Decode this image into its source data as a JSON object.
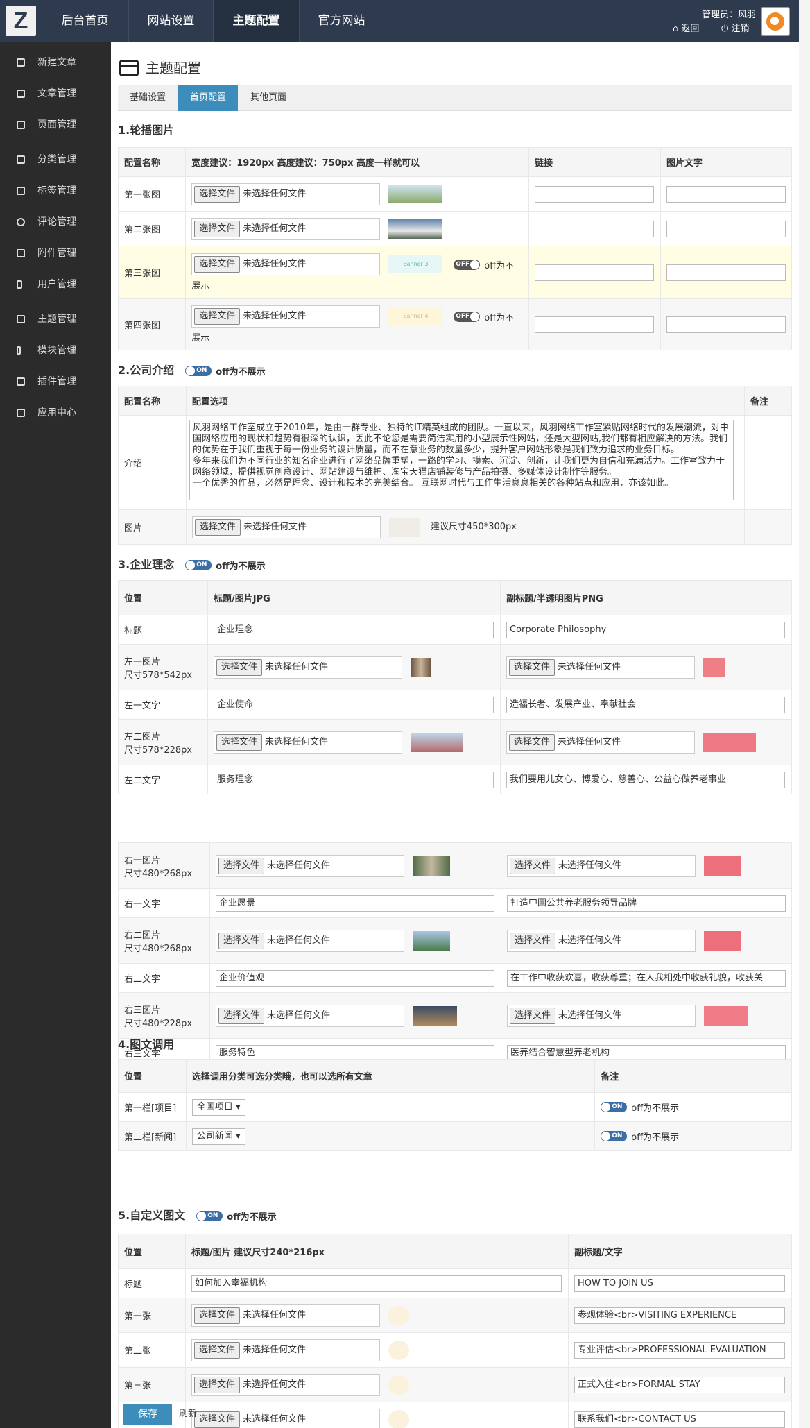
{
  "nav": {
    "items": [
      "后台首页",
      "网站设置",
      "主题配置",
      "官方网站"
    ],
    "active_index": 2,
    "admin_label": "管理员：风羽",
    "back_label": "返回",
    "logout_label": "注销"
  },
  "sidebar": {
    "items": [
      "新建文章",
      "文章管理",
      "页面管理",
      "分类管理",
      "标签管理",
      "评论管理",
      "附件管理",
      "用户管理",
      "主题管理",
      "模块管理",
      "插件管理",
      "应用中心"
    ]
  },
  "page": {
    "title": "主题配置"
  },
  "tabs": [
    "基础设置",
    "首页配置",
    "其他页面"
  ],
  "file": {
    "button": "选择文件",
    "none": "未选择任何文件"
  },
  "banner": {
    "section_title": "1.轮播图片",
    "headers": {
      "name": "配置名称",
      "size": "宽度建议：1920px   高度建议：750px   高度一样就可以",
      "link": "链接",
      "caption": "图片文字"
    },
    "rows": [
      "第一张图",
      "第二张图",
      "第三张图",
      "第四张图"
    ],
    "thumb3": "Banner 3",
    "thumb4": "Banner 4",
    "switch_off": "OFF",
    "off_note": "off为不",
    "off_note2": "展示"
  },
  "company": {
    "section_title": "2.公司介绍",
    "switch_on": "ON",
    "switch_note": "off为不展示",
    "headers": {
      "name": "配置名称",
      "option": "配置选项",
      "remark": "备注"
    },
    "intro_label": "介绍",
    "intro_text": "风羽网络工作室成立于2010年，是由一群专业、独特的IT精英组成的团队。一直以来，风羽网络工作室紧贴网络时代的发展潮流，对中国网络应用的现状和趋势有很深的认识，因此不论您是需要简洁实用的小型展示性网站，还是大型网站,我们都有相应解决的方法。我们的优势在于我们重视于每一份业务的设计质量，而不在意业务的数量多少，提升客户网站形象是我们致力追求的业务目标。\n多年来我们为不同行业的知名企业进行了网络品牌重塑，一路的学习、摸索、沉淀、创新，让我们更为自信和充满活力。工作室致力于网络领域，提供视觉创意设计、网站建设与维护、淘宝天猫店铺装修与产品拍摄、多媒体设计制作等服务。\n一个优秀的作品，必然是理念、设计和技术的完美结合。 互联网时代与工作生活息息相关的各种站点和应用，亦该如此。",
    "image_label": "图片",
    "image_hint": "建议尺寸450*300px"
  },
  "philosophy": {
    "section_title": "3.企业理念",
    "switch_on": "ON",
    "switch_note": "off为不展示",
    "headers": {
      "pos": "位置",
      "title": "标题/图片JPG",
      "sub": "副标题/半透明图片PNG"
    },
    "rows": [
      {
        "label": "标题",
        "type": "text",
        "a": "企业理念",
        "b": "Corporate Philosophy"
      },
      {
        "label": "左一图片",
        "label2": "尺寸578*542px",
        "type": "file"
      },
      {
        "label": "左一文字",
        "type": "text",
        "a": "企业使命",
        "b": "造福长者、发展产业、奉献社会"
      },
      {
        "label": "左二图片",
        "label2": "尺寸578*228px",
        "type": "file"
      },
      {
        "label": "左二文字",
        "type": "text",
        "a": "服务理念",
        "b": "我们要用儿女心、博爱心、慈善心、公益心做养老事业"
      }
    ],
    "rows2": [
      {
        "label": "右一图片",
        "label2": "尺寸480*268px",
        "type": "file"
      },
      {
        "label": "右一文字",
        "type": "text",
        "a": "企业愿景",
        "b": "打造中国公共养老服务领导品牌"
      },
      {
        "label": "右二图片",
        "label2": "尺寸480*268px",
        "type": "file"
      },
      {
        "label": "右二文字",
        "type": "text",
        "a": "企业价值观",
        "b": "在工作中收获欢喜，收获尊重；在人我相处中收获礼貌，收获关"
      },
      {
        "label": "右三图片",
        "label2": "尺寸480*228px",
        "type": "file"
      },
      {
        "label": "右三文字",
        "type": "text",
        "a": "服务特色",
        "b": "医养结合智慧型养老机构"
      }
    ]
  },
  "imgtext": {
    "section_title": "4.图文调用",
    "headers": {
      "pos": "位置",
      "choose": "选择调用分类可选分类哦，也可以选所有文章",
      "remark": "备注"
    },
    "rows": [
      {
        "label": "第一栏[项目]",
        "select": "全国项目"
      },
      {
        "label": "第二栏[新闻]",
        "select": "公司新闻"
      }
    ],
    "switch_on": "ON",
    "switch_note": "off为不展示"
  },
  "custom": {
    "section_title": "5.自定义图文",
    "switch_on": "ON",
    "switch_note": "off为不展示",
    "headers": {
      "pos": "位置",
      "title": "标题/图片   建议尺寸240*216px",
      "sub": "副标题/文字"
    },
    "title_label": "标题",
    "title_a": "如何加入幸福机构",
    "title_b": "HOW TO JOIN US",
    "rows": [
      {
        "label": "第一张",
        "b": "参观体验<br>VISITING EXPERIENCE"
      },
      {
        "label": "第二张",
        "b": "专业评估<br>PROFESSIONAL EVALUATION"
      },
      {
        "label": "第三张",
        "b": "正式入住<br>FORMAL STAY"
      },
      {
        "label": "第四张",
        "b": "联系我们<br>CONTACT US"
      }
    ]
  },
  "actions": {
    "save": "保存",
    "refresh": "刷新"
  },
  "colors": {
    "topbar": "#2e3a4d",
    "sidebar": "#2b2b2b",
    "accent": "#3c8dbc",
    "highlight_row": "#fffde4"
  }
}
